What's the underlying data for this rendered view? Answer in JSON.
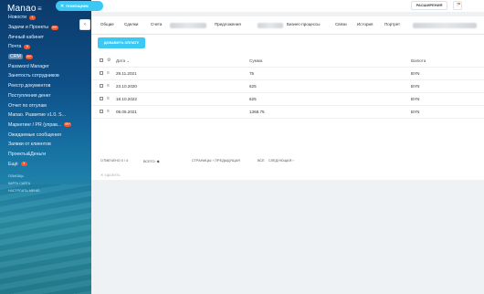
{
  "app": {
    "brand": "Manao",
    "menu_glyph": "≡",
    "notify_label": "ПОМОЩНИК"
  },
  "topbar": {
    "extensions_label": "РАСШИРЕНИЯ",
    "help_glyph": "?"
  },
  "sidebar": {
    "items": [
      {
        "label": "Новости",
        "badge": "1"
      },
      {
        "label": "Задачи и Проекты",
        "badge": "99+"
      },
      {
        "label": "Личный кабинет",
        "badge": ""
      },
      {
        "label": "Почта",
        "badge": "8"
      },
      {
        "label": "CRM",
        "badge": "99+"
      },
      {
        "label": "Password Manager",
        "badge": ""
      },
      {
        "label": "Занятость сотрудников",
        "badge": ""
      },
      {
        "label": "Реестр документов",
        "badge": ""
      },
      {
        "label": "Поступления денег",
        "badge": ""
      },
      {
        "label": "Отчет по отгулам",
        "badge": ""
      },
      {
        "label": "Manao. Развитие v1.0. S...",
        "badge": ""
      },
      {
        "label": "Маркетинг / PR (управ...",
        "badge": "99+"
      },
      {
        "label": "Ожидаемые сообщения",
        "badge": ""
      },
      {
        "label": "Заявки от клиентов",
        "badge": ""
      },
      {
        "label": "Проекты&Деньги",
        "badge": ""
      },
      {
        "label": "Ещё",
        "badge": "3"
      }
    ],
    "footer": [
      "ПОМОЩЬ",
      "КАРТА САЙТА",
      "НАСТРОИТЬ МЕНЮ"
    ]
  },
  "tabs": [
    {
      "label": "Общие"
    },
    {
      "label": "Сделки"
    },
    {
      "label": "Счета"
    },
    {
      "label": "Предложения"
    },
    {
      "label": "Бизнес-процессы"
    },
    {
      "label": "Связи"
    },
    {
      "label": "История"
    },
    {
      "label": "Портрет"
    }
  ],
  "toolbar": {
    "add_payment_label": "ДОБАВИТЬ ОПЛАТУ"
  },
  "table": {
    "columns": {
      "date": "Дата",
      "amount": "Сумма",
      "currency": "Валюта"
    },
    "sort_glyph": "⌄",
    "rows": [
      {
        "date": "29.11.2021",
        "amount": "75",
        "currency": "BYN"
      },
      {
        "date": "23.10.2020",
        "amount": "625",
        "currency": "BYN"
      },
      {
        "date": "18.10.2022",
        "amount": "625",
        "currency": "BYN"
      },
      {
        "date": "08.05.2021",
        "amount": "1368.75",
        "currency": "BYN"
      }
    ]
  },
  "footer": {
    "selected": "ОТМЕЧЕНО 0 / 4",
    "total": "ВСЕГО: ◆",
    "pages": "СТРАНИЦЫ:",
    "prev": "‹ ПРЕДЫДУЩАЯ",
    "all": "ВСЕ",
    "next": "СЛЕДУЮЩАЯ ›",
    "delete": "✕ УДАЛИТЬ"
  }
}
